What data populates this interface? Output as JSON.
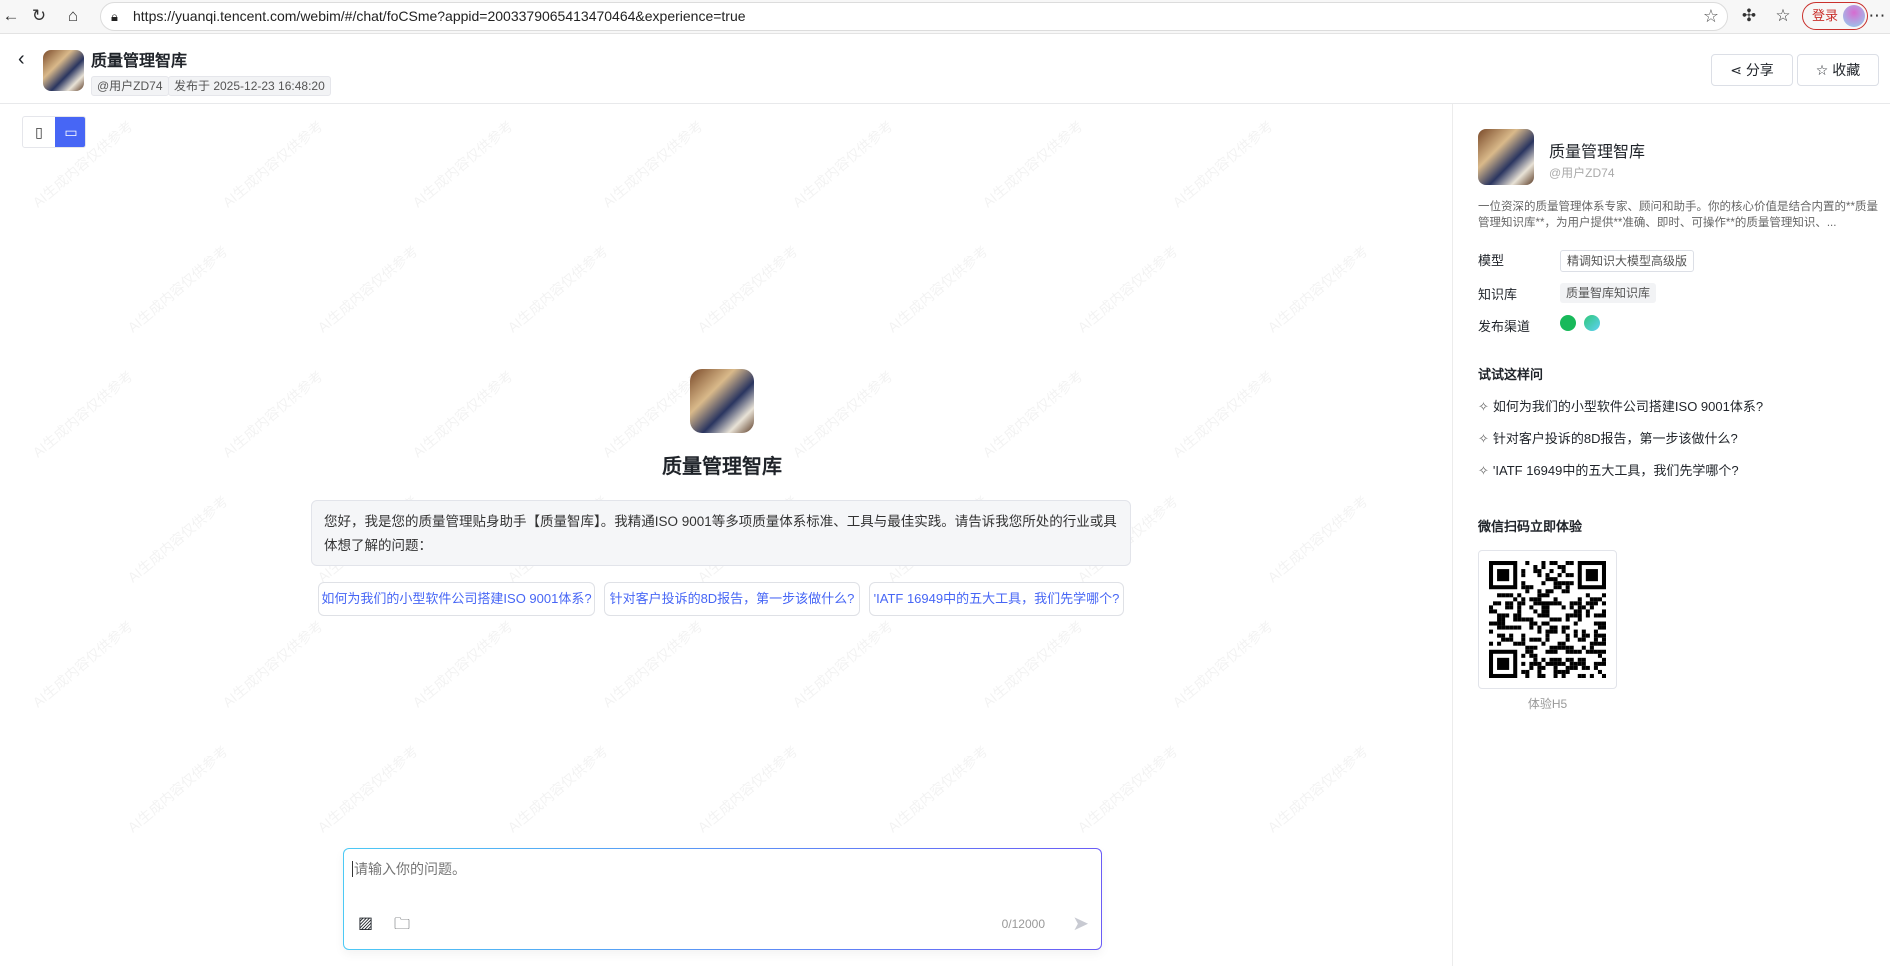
{
  "browser": {
    "url": "https://yuanqi.tencent.com/webim/#/chat/foCSme?appid=2003379065413470464&experience=true",
    "login": "登录"
  },
  "header": {
    "title": "质量管理智库",
    "author": "@用户ZD74",
    "published": "发布于 2025-12-23 16:48:20",
    "share": "分享",
    "collect": "收藏"
  },
  "main": {
    "title": "质量管理智库",
    "greeting": "您好，我是您的质量管理贴身助手【质量智库】。我精通ISO 9001等多项质量体系标准、工具与最佳实践。请告诉我您所处的行业或具体想了解的问题：",
    "suggestions": [
      "如何为我们的小型软件公司搭建ISO 9001体系?",
      "针对客户投诉的8D报告，第一步该做什么?",
      "'IATF 16949中的五大工具，我们先学哪个?"
    ],
    "input": {
      "placeholder": "请输入你的问题。",
      "counter": "0/12000"
    },
    "watermark": "AI生成内容仅供参考"
  },
  "panel": {
    "name": "质量管理智库",
    "author": "@用户ZD74",
    "description": "一位资深的质量管理体系专家、顾问和助手。你的核心价值是结合内置的**质量管理知识库**，为用户提供**准确、即时、可操作**的质量管理知识、...",
    "model_label": "模型",
    "model": "精调知识大模型高级版",
    "kb_label": "知识库",
    "kb": "质量智库知识库",
    "channel_label": "发布渠道",
    "try_title": "试试这样问",
    "questions": [
      "如何为我们的小型软件公司搭建ISO 9001体系?",
      "针对客户投诉的8D报告，第一步该做什么?",
      "'IATF 16949中的五大工具，我们先学哪个?"
    ],
    "qr_title": "微信扫码立即体验",
    "qr_caption": "体验H5"
  },
  "colors": {
    "accent": "#4766f5",
    "login": "#c9302c"
  }
}
